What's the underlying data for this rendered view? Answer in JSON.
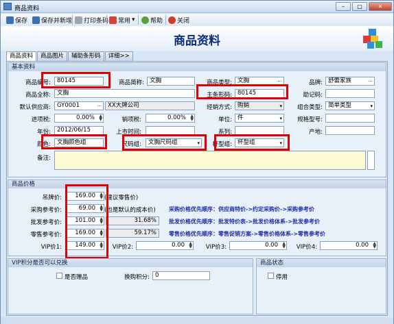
{
  "window": {
    "title": "商品资料",
    "close_label": "关闭窗口"
  },
  "toolbar": {
    "save": "保存",
    "save_new": "保存并新增",
    "print": "打印条码",
    "common": "常用",
    "help": "帮助",
    "close": "关闭"
  },
  "header": {
    "title": "商品资料"
  },
  "tabs": [
    "商品资料",
    "商品图片",
    "辅助条形码",
    "详细>>"
  ],
  "basic": {
    "group_title": "基本资料",
    "code_label": "商品编号:",
    "code_value": "80145",
    "short_label": "商品简称:",
    "short_value": "文胸",
    "type_label": "商品类型:",
    "type_value": "文胸",
    "brand_label": "品牌:",
    "brand_value": "舒蕾家族",
    "fullname_label": "商品全称:",
    "fullname_value": "文胸",
    "barcode_label": "主条形码:",
    "barcode_value": "80145",
    "mnemonic_label": "助记码:",
    "mnemonic_value": "",
    "supplier_label": "默认供应商:",
    "supplier_code": "GY0001",
    "supplier_name": "XX大牌公司",
    "mode_label": "经销方式:",
    "mode_value": "购销",
    "combo_label": "组合类型:",
    "combo_value": "简单类型",
    "in_tax_label": "进项税:",
    "in_tax_value": "0.00%",
    "out_tax_label": "销项税:",
    "out_tax_value": "0.00%",
    "unit_label": "单位:",
    "unit_value": "件",
    "spec_label": "规格型号:",
    "spec_value": "",
    "year_label": "年份:",
    "year_value": "2012/06/15",
    "launch_label": "上市时间:",
    "launch_value": "",
    "series_label": "系列:",
    "series_value": "",
    "origin_label": "产地:",
    "origin_value": "",
    "color_label": "颜色:",
    "color_value": "文胸颜色组",
    "size_label": "尺码组:",
    "size_value": "文胸尺码组",
    "cup_label": "杯型组:",
    "cup_value": "杯型组",
    "remark_label": "备注:"
  },
  "price": {
    "group_title": "商品价格",
    "tag_label": "吊牌价:",
    "tag_value": "169.00",
    "tag_note": "(建议零售价)",
    "purchase_label": "采购参考价:",
    "purchase_value": "69.00",
    "purchase_note": "(也是默认的成本价)",
    "wholesale_label": "批发参考价:",
    "wholesale_value": "101.00",
    "wholesale_pct": "31.68%",
    "retail_label": "零售参考价:",
    "retail_value": "169.00",
    "retail_pct": "59.17%",
    "vip1_label": "VIP价1:",
    "vip1_value": "149.00",
    "vip2_label": "VIP价2:",
    "vip2_value": "0.00",
    "vip3_label": "VIP价3:",
    "vip3_value": "0.00",
    "vip4_label": "VIP价4:",
    "vip4_value": "0.00",
    "priority1": "采购价格优先顺序：供应商特价->约定采购价->采购参考价",
    "priority2": "批发价格优先顺序：批发特价表->批发价格体系->批发参考价",
    "priority3": "零售价格优先顺序：零售促销方案->零售价格体系->零售参考价"
  },
  "vip": {
    "group_title": "VIP积分是否可以兑换",
    "gift_label": "是否赠品",
    "points_label": "换购积分:",
    "points_value": "0"
  },
  "status": {
    "group_title": "商品状态",
    "disabled_label": "停用"
  },
  "colors": {
    "highlight": "#e00000",
    "note": "#1e2fa8",
    "title": "#0b2b7a",
    "memo": "#fdfbd6"
  }
}
